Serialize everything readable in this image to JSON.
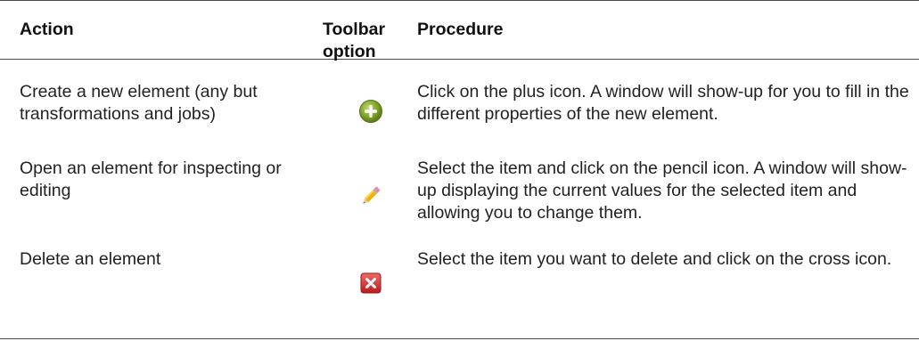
{
  "table": {
    "headers": {
      "action": "Action",
      "toolbar_option_line1": "Toolbar",
      "toolbar_option_line2": "option",
      "procedure": "Procedure"
    },
    "rows": [
      {
        "action": "Create a new element (any but transformations and jobs)",
        "icon": "plus-icon",
        "procedure": "Click on the plus icon. A window will show-up for you to fill in the different properties of the new element."
      },
      {
        "action": "Open an element for inspecting or editing",
        "icon": "pencil-icon",
        "procedure": "Select the item and click on the pencil icon. A window will show-up displaying the current values for the selected item and allowing you to change them."
      },
      {
        "action": "Delete an element",
        "icon": "delete-cross-icon",
        "procedure": "Select the item you want to delete and click on the cross icon."
      }
    ]
  },
  "colors": {
    "plus_icon": "#7fa32a",
    "delete_icon": "#cc2a2a",
    "pencil_icon": "#f0b400"
  }
}
